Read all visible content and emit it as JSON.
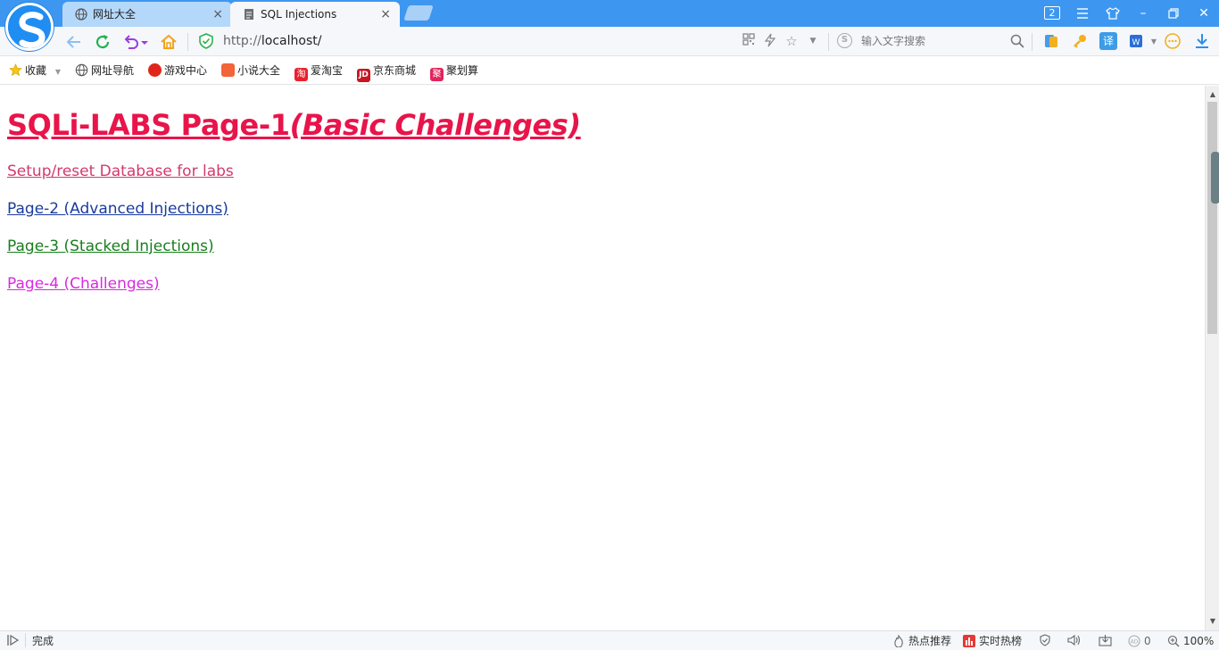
{
  "tabs": [
    {
      "title": "网址大全",
      "close": "×"
    },
    {
      "title": "SQL Injections",
      "close": "×"
    }
  ],
  "window": {
    "tab_count": "2",
    "minimize": "–",
    "close": "✕"
  },
  "address": {
    "prefix": "http://",
    "host": "localhost/"
  },
  "search": {
    "placeholder": "输入文字搜索"
  },
  "bookmarks": [
    {
      "label": "收藏"
    },
    {
      "label": "网址导航"
    },
    {
      "label": "游戏中心"
    },
    {
      "label": "小说大全"
    },
    {
      "label": "爱淘宝"
    },
    {
      "label": "京东商城"
    },
    {
      "label": "聚划算"
    }
  ],
  "page": {
    "heading_main": "SQLi-LABS Page-1",
    "heading_sub": "(Basic Challenges)",
    "links": [
      {
        "label": "Setup/reset Database for labs"
      },
      {
        "label": "Page-2 (Advanced Injections)"
      },
      {
        "label": "Page-3 (Stacked Injections)"
      },
      {
        "label": "Page-4 (Challenges)"
      }
    ]
  },
  "status": {
    "text": "完成",
    "hot_recommend": "热点推荐",
    "realtime_hot": "实时热榜",
    "counter": "0",
    "zoom": "100%"
  },
  "colors": {
    "titlebar": "#3d97f1",
    "heading": "#e8144a",
    "link_setup": "#d23a6c",
    "link_page2": "#1a3b9e",
    "link_page3": "#187e1d",
    "link_page4": "#d82ae0"
  }
}
